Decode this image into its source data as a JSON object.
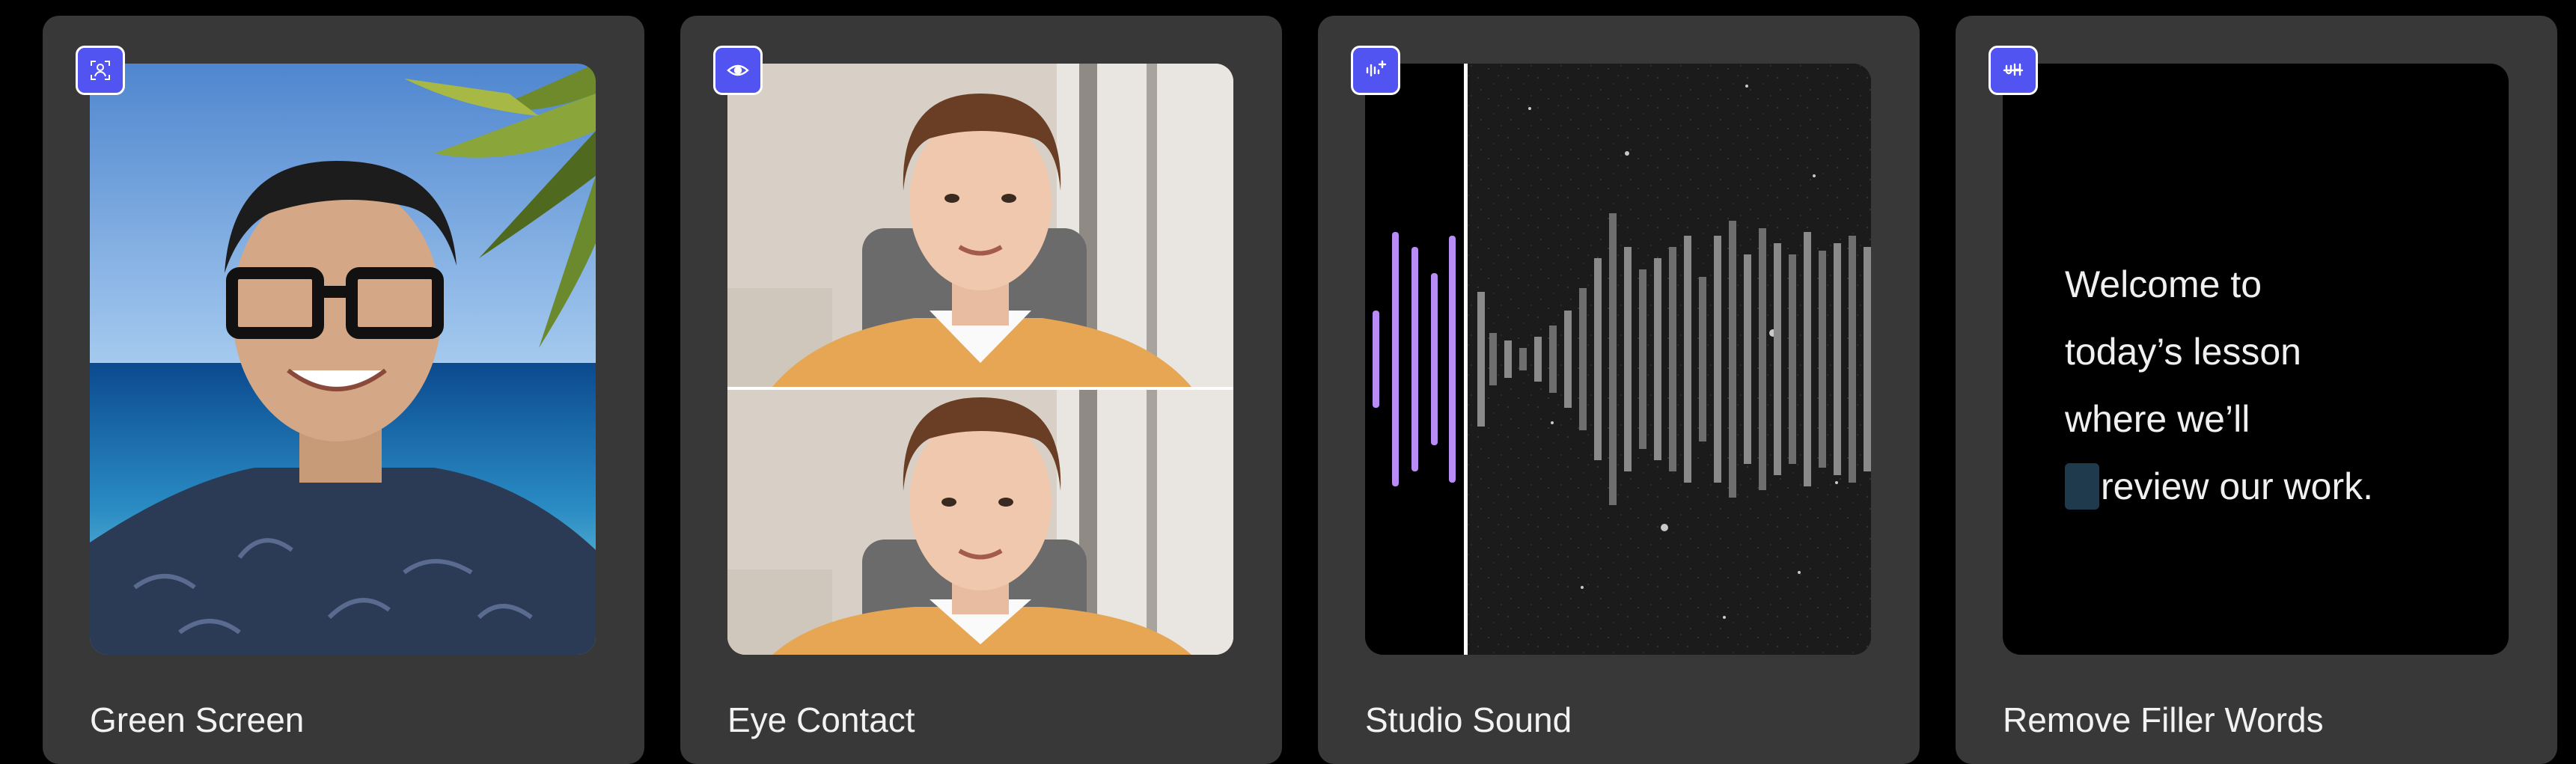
{
  "cards": [
    {
      "title": "Green Screen",
      "icon": "person-select-icon"
    },
    {
      "title": "Eye Contact",
      "icon": "eye-icon"
    },
    {
      "title": "Studio Sound",
      "icon": "audio-sparkle-icon"
    },
    {
      "title": "Remove Filler Words",
      "icon": "strikethrough-uh-icon",
      "transcript": [
        "Welcome to",
        "today’s lesson",
        "where we’ll",
        "review our work."
      ]
    }
  ],
  "colors": {
    "badge": "#5254f2",
    "card": "#383838",
    "waveform_active": "#b98cf5"
  }
}
